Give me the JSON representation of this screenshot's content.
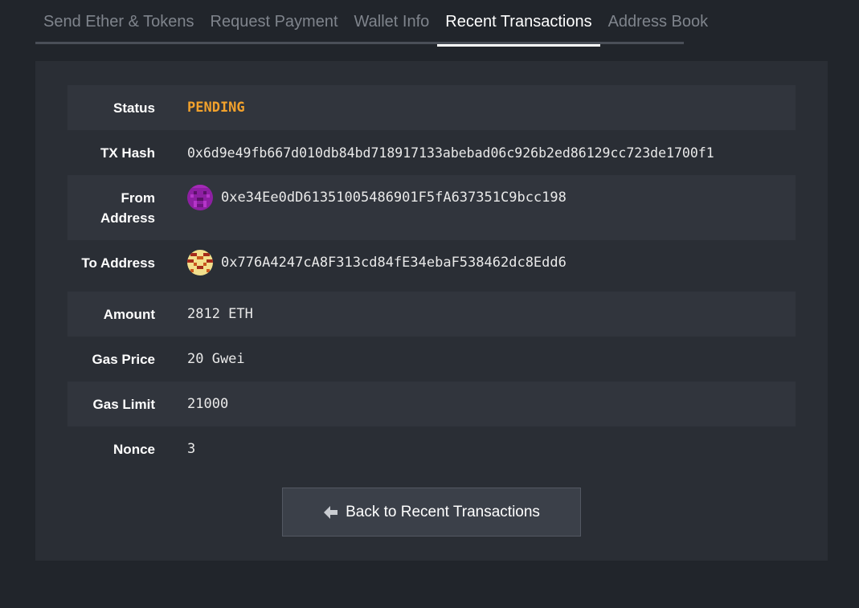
{
  "tabs": [
    {
      "label": "Send Ether & Tokens",
      "active": false
    },
    {
      "label": "Request Payment",
      "active": false
    },
    {
      "label": "Wallet Info",
      "active": false
    },
    {
      "label": "Recent Transactions",
      "active": true
    },
    {
      "label": "Address Book",
      "active": false
    }
  ],
  "details": {
    "status_label": "Status",
    "status_value": "PENDING",
    "tx_hash_label": "TX Hash",
    "tx_hash_value": "0x6d9e49fb667d010db84bd718917133abebad06c926b2ed86129cc723de1700f1",
    "from_label_line1": "From",
    "from_label_line2": "Address",
    "from_value": "0xe34Ee0dD61351005486901F5fA637351C9bcc198",
    "to_label": "To Address",
    "to_value": "0x776A4247cA8F313cd84fE34ebaF538462dc8Edd6",
    "amount_label": "Amount",
    "amount_value": "2812 ETH",
    "gas_price_label": "Gas Price",
    "gas_price_value": "20 Gwei",
    "gas_limit_label": "Gas Limit",
    "gas_limit_value": "21000",
    "nonce_label": "Nonce",
    "nonce_value": "3"
  },
  "back_button": {
    "label": "Back to Recent Transactions",
    "icon": "arrow-left-icon"
  },
  "colors": {
    "background": "#21252b",
    "panel": "#2a2e35",
    "row_shade": "#31353d",
    "pending": "#f3a22c",
    "button": "#3b4049"
  }
}
